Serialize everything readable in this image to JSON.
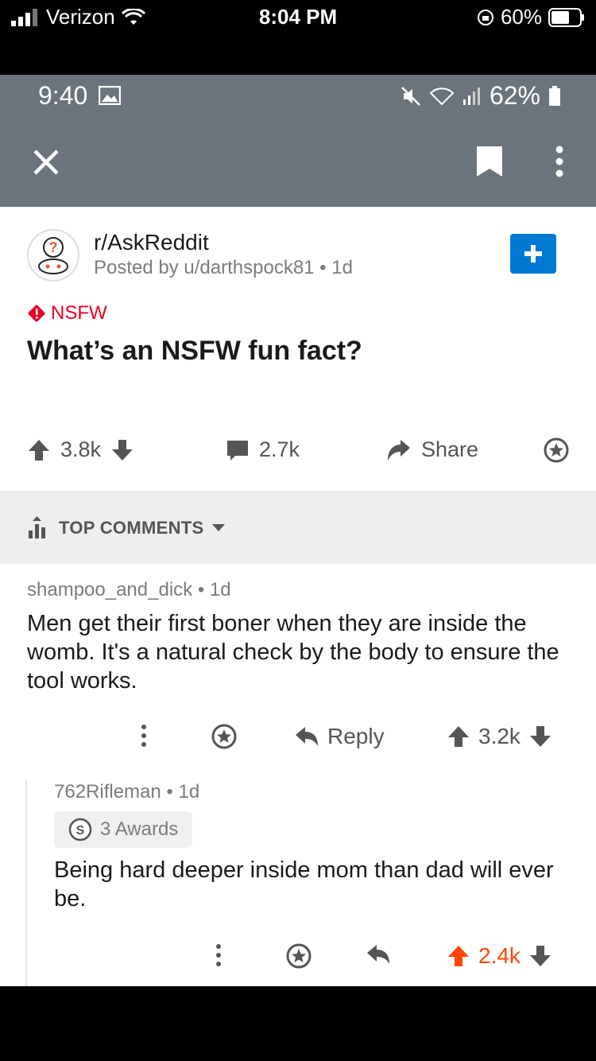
{
  "ios_status": {
    "carrier": "Verizon",
    "time": "8:04 PM",
    "battery": "60%"
  },
  "android_status": {
    "time": "9:40",
    "battery": "62%"
  },
  "post": {
    "subreddit": "r/AskReddit",
    "byline": "Posted by u/darthspock81 • 1d",
    "nsfw_label": "NSFW",
    "title": "What’s an NSFW fun fact?",
    "upvotes": "3.8k",
    "comments": "2.7k",
    "share_label": "Share"
  },
  "sort": {
    "label": "TOP COMMENTS"
  },
  "comments": [
    {
      "meta": "shampoo_and_dick • 1d",
      "body": "Men get their first boner when they are inside the womb. It's a natural check by the body to ensure the tool works.",
      "reply_label": "Reply",
      "score": "3.2k"
    },
    {
      "meta": "762Rifleman • 1d",
      "awards": "3 Awards",
      "body": "Being hard deeper inside mom than dad will ever be.",
      "score": "2.4k"
    }
  ],
  "colors": {
    "upvoted": "#ff4500",
    "nsfw": "#ea0027",
    "join": "#0079d3",
    "toolbar": "#6b737c"
  }
}
